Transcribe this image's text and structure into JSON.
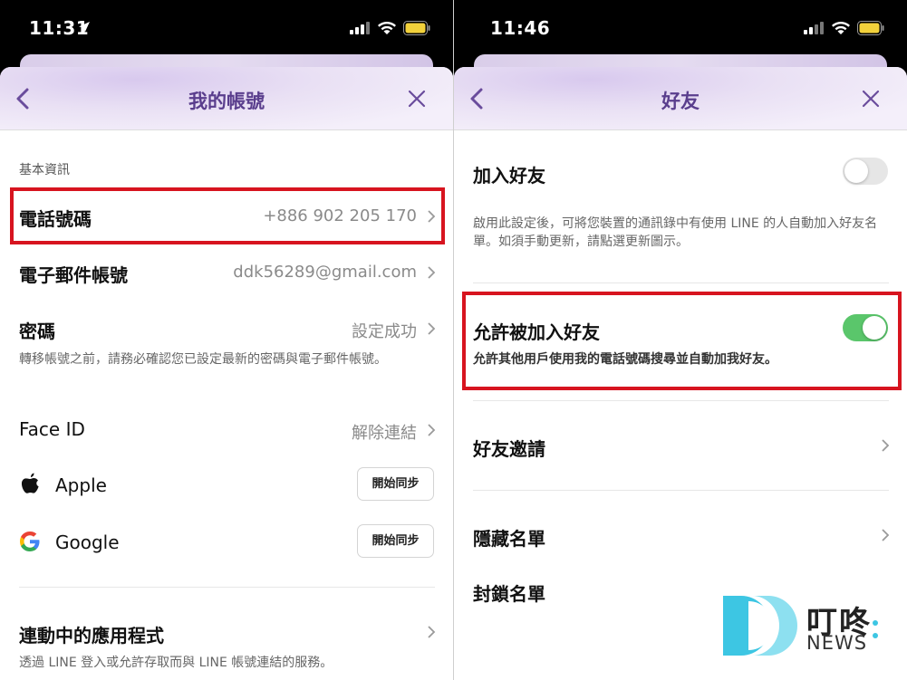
{
  "colors": {
    "accent_purple": "#5a3e8d",
    "highlight_red": "#d7141f",
    "toggle_on": "#5ac66b",
    "toggle_off": "#e6e6e6"
  },
  "left": {
    "status_time": "11:31",
    "nav_title": "我的帳號",
    "section_label": "基本資訊",
    "phone": {
      "label": "電話號碼",
      "value": "+886 902 205 170"
    },
    "email": {
      "label": "電子郵件帳號",
      "value": "ddk56289@gmail.com"
    },
    "password": {
      "label": "密碼",
      "value": "設定成功",
      "desc": "轉移帳號之前，請務必確認您已設定最新的密碼與電子郵件帳號。"
    },
    "face_id": {
      "label": "Face ID",
      "value": "解除連結"
    },
    "apple": {
      "label": "Apple",
      "button": "開始同步"
    },
    "google": {
      "label": "Google",
      "button": "開始同步"
    },
    "apps": {
      "label": "連動中的應用程式",
      "desc": "透過 LINE 登入或允許存取而與 LINE 帳號連結的服務。"
    }
  },
  "right": {
    "status_time": "11:46",
    "nav_title": "好友",
    "add_friends": {
      "label": "加入好友",
      "toggle": "off",
      "desc": "啟用此設定後，可將您裝置的通訊錄中有使用 LINE 的人自動加入好友名單。如須手動更新，請點選更新圖示。"
    },
    "allow_add": {
      "label": "允許被加入好友",
      "toggle": "on",
      "desc": "允許其他用戶使用我的電話號碼搜尋並自動加我好友。"
    },
    "invite": {
      "label": "好友邀請"
    },
    "hidden": {
      "label": "隱藏名單"
    },
    "blocked": {
      "label": "封鎖名單"
    }
  },
  "watermark": {
    "cn": "叮咚",
    "en": "NEWS"
  }
}
